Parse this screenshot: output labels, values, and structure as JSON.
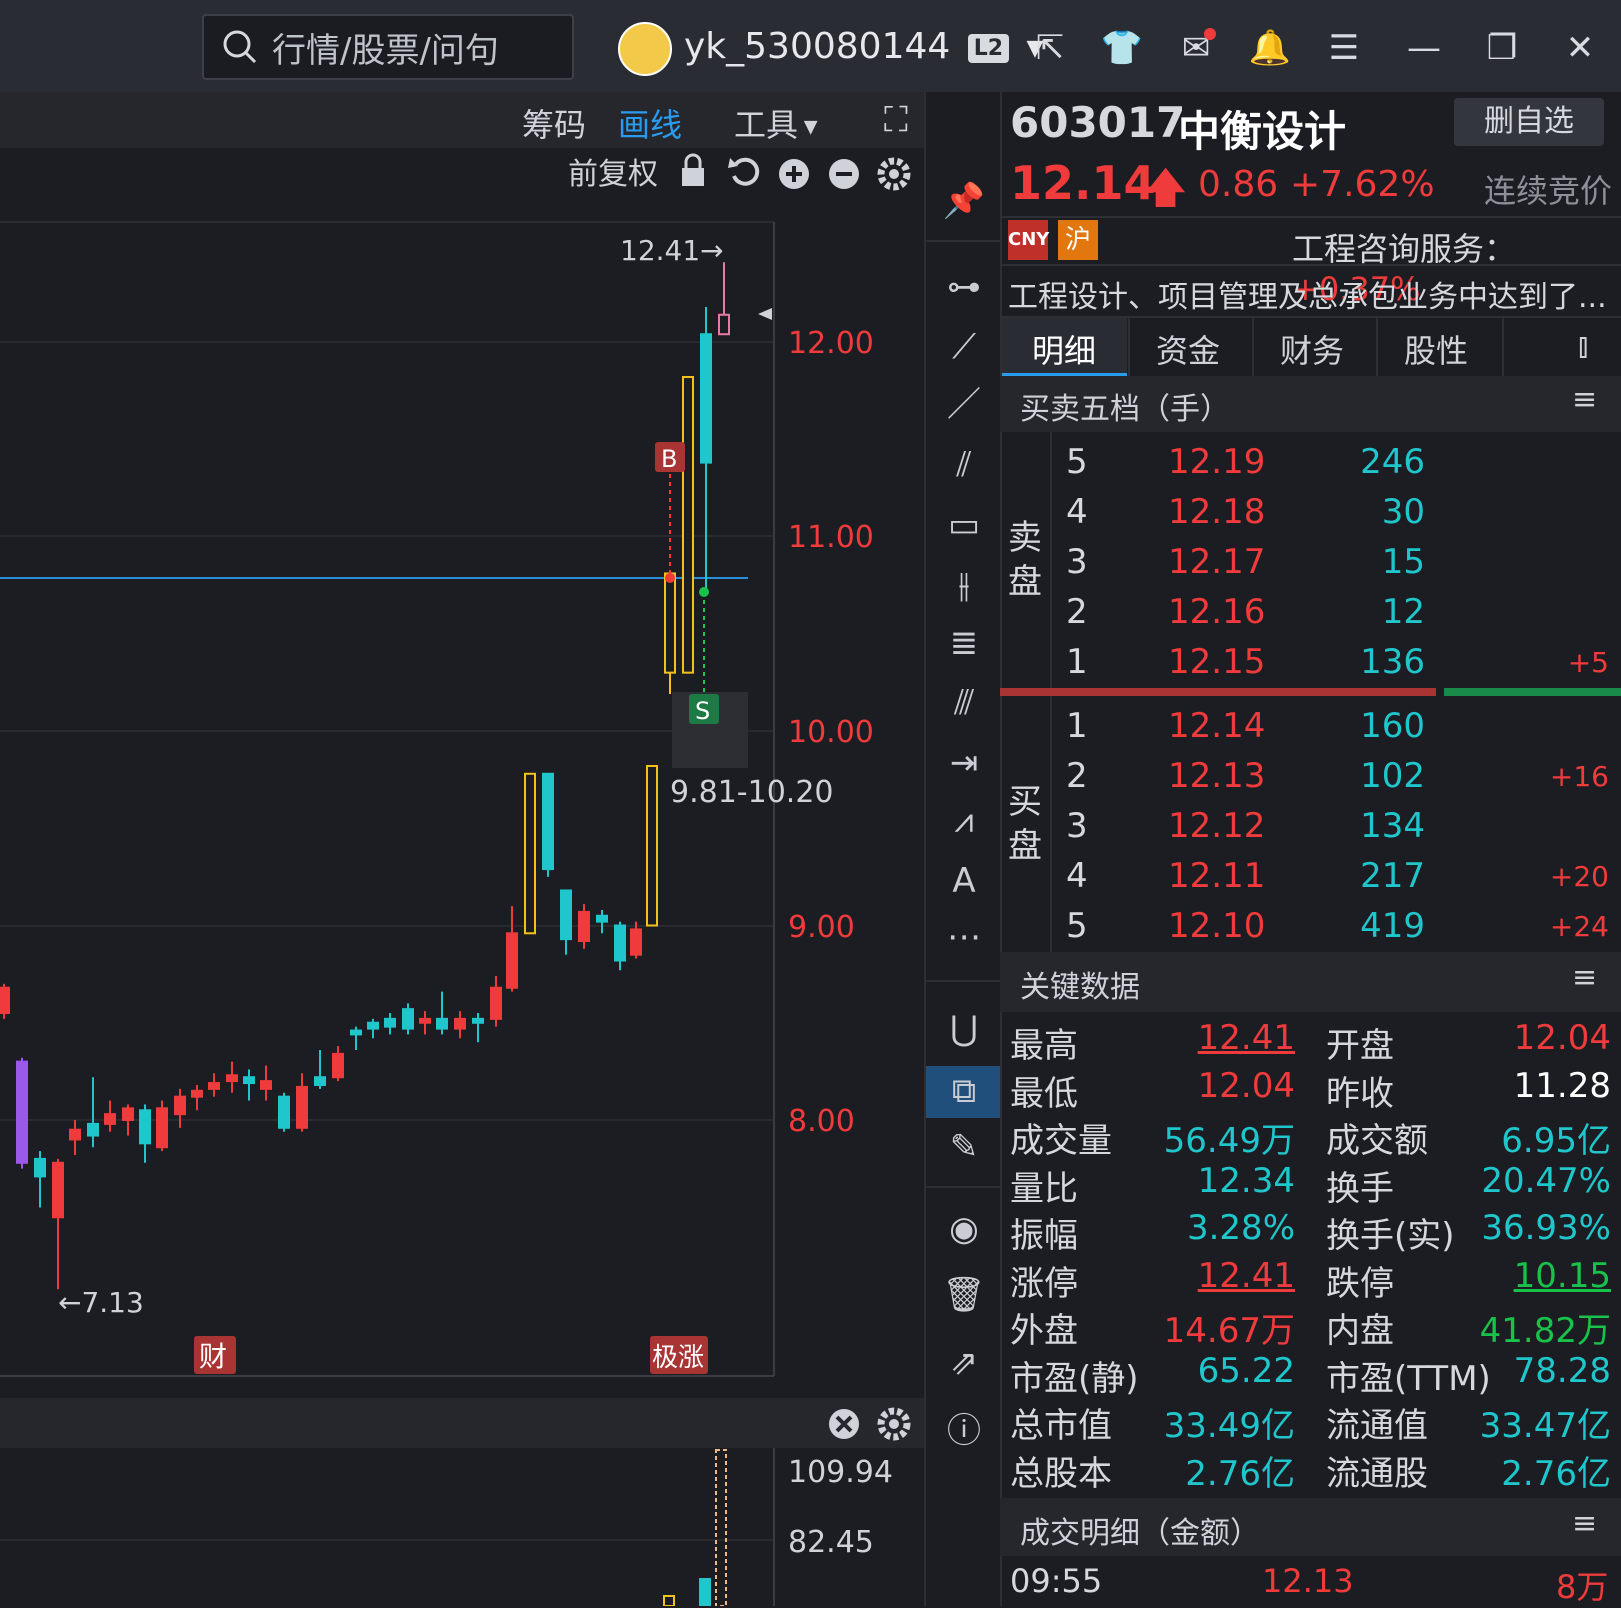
{
  "search": {
    "placeholder": "行情/股票/问句"
  },
  "user": {
    "name": "yk_530080144",
    "badge": "L2"
  },
  "chart_toolbar": {
    "chouma": "筹码",
    "huaxian": "画线",
    "gongju": "工具",
    "fuquan": "前复权"
  },
  "chart": {
    "y_ticks": [
      "12.00",
      "11.00",
      "10.00",
      "9.00",
      "8.00"
    ],
    "high_label": "12.41→",
    "low_label": "←7.13",
    "range_label": "9.81-10.20",
    "b_marker": "B",
    "s_marker": "S",
    "cai_badge": "财",
    "zhang_badge": "极涨",
    "vol_ticks": [
      "109.94",
      "82.45"
    ]
  },
  "stock": {
    "code": "603017",
    "name": "中衡设计",
    "action": "删自选",
    "price": "12.14",
    "change": "0.86",
    "pct": "+7.62%",
    "status": "连续竞价",
    "cny": "CNY",
    "market": "沪",
    "sector": "工程咨询服务：",
    "sector_pct": "+0.37%",
    "desc": "工程设计、项目管理及总承包业务中达到了..."
  },
  "tabs": [
    "明细",
    "资金",
    "财务",
    "股性"
  ],
  "orderbook": {
    "title": "买卖五档（手）",
    "sell_label": "卖盘",
    "buy_label": "买盘",
    "sell": [
      {
        "lvl": "5",
        "price": "12.19",
        "vol": "246",
        "delta": ""
      },
      {
        "lvl": "4",
        "price": "12.18",
        "vol": "30",
        "delta": ""
      },
      {
        "lvl": "3",
        "price": "12.17",
        "vol": "15",
        "delta": ""
      },
      {
        "lvl": "2",
        "price": "12.16",
        "vol": "12",
        "delta": ""
      },
      {
        "lvl": "1",
        "price": "12.15",
        "vol": "136",
        "delta": "+5"
      }
    ],
    "buy": [
      {
        "lvl": "1",
        "price": "12.14",
        "vol": "160",
        "delta": ""
      },
      {
        "lvl": "2",
        "price": "12.13",
        "vol": "102",
        "delta": "+16"
      },
      {
        "lvl": "3",
        "price": "12.12",
        "vol": "134",
        "delta": ""
      },
      {
        "lvl": "4",
        "price": "12.11",
        "vol": "217",
        "delta": "+20"
      },
      {
        "lvl": "5",
        "price": "12.10",
        "vol": "419",
        "delta": "+24"
      }
    ]
  },
  "keydata": {
    "title": "关键数据",
    "rows": [
      {
        "l1": "最高",
        "v1": "12.41",
        "c1": "red",
        "u1": true,
        "l2": "开盘",
        "v2": "12.04",
        "c2": "red"
      },
      {
        "l1": "最低",
        "v1": "12.04",
        "c1": "red",
        "l2": "昨收",
        "v2": "11.28",
        "c2": "white"
      },
      {
        "l1": "成交量",
        "v1": "56.49万",
        "c1": "teal",
        "l2": "成交额",
        "v2": "6.95亿",
        "c2": "teal"
      },
      {
        "l1": "量比",
        "v1": "12.34",
        "c1": "teal",
        "l2": "换手",
        "v2": "20.47%",
        "c2": "teal"
      },
      {
        "l1": "振幅",
        "v1": "3.28%",
        "c1": "teal",
        "l2": "换手(实)",
        "v2": "36.93%",
        "c2": "teal"
      },
      {
        "l1": "涨停",
        "v1": "12.41",
        "c1": "red",
        "u1": true,
        "l2": "跌停",
        "v2": "10.15",
        "c2": "green",
        "u2": true
      },
      {
        "l1": "外盘",
        "v1": "14.67万",
        "c1": "red",
        "l2": "内盘",
        "v2": "41.82万",
        "c2": "green"
      },
      {
        "l1": "市盈(静)",
        "v1": "65.22",
        "c1": "teal",
        "l2": "市盈(TTM)",
        "v2": "78.28",
        "c2": "teal"
      },
      {
        "l1": "总市值",
        "v1": "33.49亿",
        "c1": "teal",
        "l2": "流通值",
        "v2": "33.47亿",
        "c2": "teal"
      },
      {
        "l1": "总股本",
        "v1": "2.76亿",
        "c1": "teal",
        "l2": "流通股",
        "v2": "2.76亿",
        "c2": "teal"
      }
    ]
  },
  "trades": {
    "title": "成交明细（金额）",
    "rows": [
      {
        "time": "09:55",
        "price": "12.13",
        "amount": "8万"
      }
    ]
  },
  "colors": {
    "up": "#ef3b3b",
    "down": "#1fc6cc",
    "yellow": "#f2c21b",
    "line": "#2a8fd8"
  }
}
